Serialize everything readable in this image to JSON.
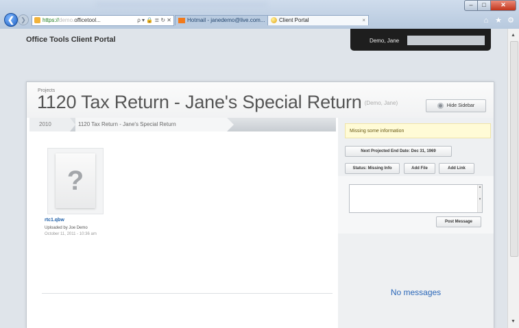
{
  "browser": {
    "address": {
      "scheme": "https://",
      "hidden": "demo.",
      "host": "officetool...",
      "controls": "ρ ▾ 🔒 ≣ ↻ ✕"
    },
    "tabs": [
      {
        "label": "Hotmail - janedemo@live.com..."
      },
      {
        "label": "Client Portal",
        "close": "×"
      }
    ],
    "window_controls": {
      "minimize": "–",
      "maximize": "□",
      "close": "✕"
    },
    "icons": {
      "back": "❮",
      "forward": "❯",
      "home": "⌂",
      "favorites": "★",
      "tools": "⚙"
    }
  },
  "app": {
    "title": "Office Tools Client Portal",
    "user": {
      "name": "Demo, Jane"
    }
  },
  "project": {
    "kicker": "Projects",
    "title": "1120 Tax Return - Jane's Special Return",
    "client": "(Demo, Jane)",
    "hide_sidebar": "Hide Sidebar",
    "breadcrumbs": [
      "2010",
      "1120 Tax Return - Jane's Special Return"
    ]
  },
  "file": {
    "thumb_glyph": "?",
    "name": "rtc1.qbw",
    "uploaded_by": "Uploaded by Joe Demo",
    "date": "October 11, 2011 - 10:36 am"
  },
  "sidebar": {
    "alert": "Missing some information",
    "end_date": "Next Projected End Date: Dec 31, 1969",
    "status": "Status: Missing Info",
    "add_file": "Add File",
    "add_link": "Add Link",
    "post_message": "Post Message",
    "no_messages": "No messages"
  },
  "colors": {
    "accent_link": "#2a67b8",
    "alert_bg": "#fffbd6",
    "user_bar": "#1e1e1e"
  }
}
